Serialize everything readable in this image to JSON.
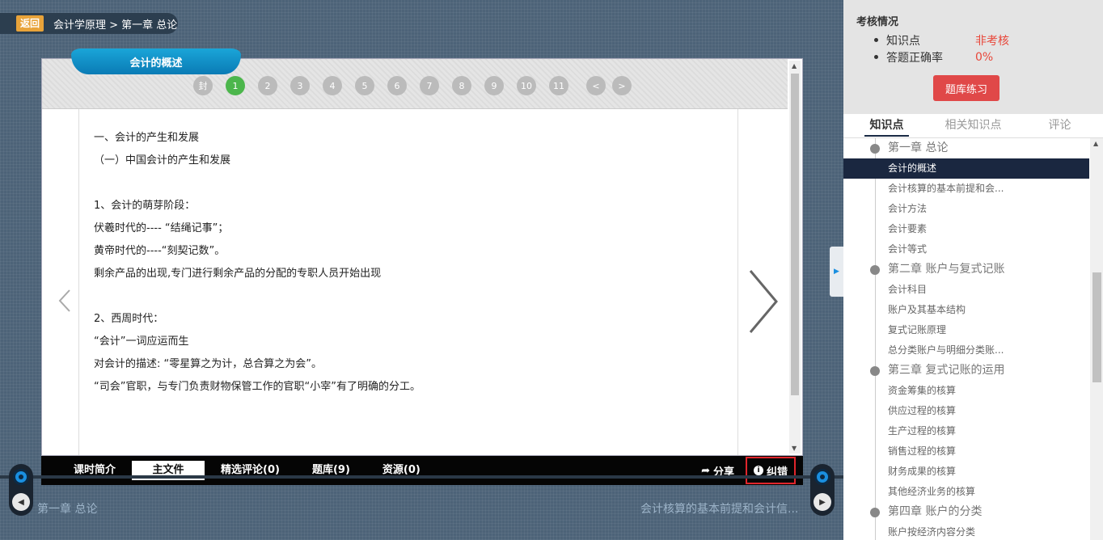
{
  "breadcrumb": {
    "back_label": "返回",
    "path": "会计学原理 > 第一章 总论"
  },
  "content": {
    "title_tab": "会计的概述",
    "pages": [
      "封",
      "1",
      "2",
      "3",
      "4",
      "5",
      "6",
      "7",
      "8",
      "9",
      "10",
      "11"
    ],
    "active_page": "1",
    "prev_page": "<",
    "next_page": ">",
    "lines": [
      "一、会计的产生和发展",
      "（一）中国会计的产生和发展",
      "",
      "1、会计的萌芽阶段：",
      "伏羲时代的---- “结绳记事”；",
      "黄帝时代的----“刻契记数”。",
      "剩余产品的出现,专门进行剩余产品的分配的专职人员开始出现",
      "",
      "2、西周时代：",
      "“会计”一词应运而生",
      "对会计的描述: “零星算之为计，总合算之为会”。",
      "“司会”官职，与专门负责财物保管工作的官职“小宰”有了明确的分工。"
    ]
  },
  "tabbar": {
    "tabs": [
      "课时简介",
      "主文件",
      "精选评论(0)",
      "题库(9)",
      "资源(0)"
    ],
    "active": "主文件",
    "share": "分享",
    "correct": "纠错"
  },
  "timeline": {
    "prev_label": "第一章 总论",
    "next_label": "会计核算的基本前提和会计信..."
  },
  "assessment": {
    "title": "考核情况",
    "rows": [
      {
        "label": "知识点",
        "value": "非考核"
      },
      {
        "label": "答题正确率",
        "value": "0%"
      }
    ],
    "practice_button": "题库练习"
  },
  "right_tabs": [
    "知识点",
    "相关知识点",
    "评论"
  ],
  "tree": [
    {
      "label": "第一章 总论",
      "type": "chapter"
    },
    {
      "label": "会计的概述",
      "type": "item",
      "active": true
    },
    {
      "label": "会计核算的基本前提和会...",
      "type": "item"
    },
    {
      "label": "会计方法",
      "type": "item"
    },
    {
      "label": "会计要素",
      "type": "item"
    },
    {
      "label": "会计等式",
      "type": "item"
    },
    {
      "label": "第二章 账户与复式记账",
      "type": "chapter"
    },
    {
      "label": "会计科目",
      "type": "item"
    },
    {
      "label": "账户及其基本结构",
      "type": "item"
    },
    {
      "label": "复式记账原理",
      "type": "item"
    },
    {
      "label": "总分类账户与明细分类账...",
      "type": "item"
    },
    {
      "label": "第三章 复式记账的运用",
      "type": "chapter"
    },
    {
      "label": "资金筹集的核算",
      "type": "item"
    },
    {
      "label": "供应过程的核算",
      "type": "item"
    },
    {
      "label": "生产过程的核算",
      "type": "item"
    },
    {
      "label": "销售过程的核算",
      "type": "item"
    },
    {
      "label": "财务成果的核算",
      "type": "item"
    },
    {
      "label": "其他经济业务的核算",
      "type": "item"
    },
    {
      "label": "第四章 账户的分类",
      "type": "chapter"
    },
    {
      "label": "账户按经济内容分类",
      "type": "item"
    }
  ],
  "colors": {
    "accent_blue": "#1a8fe0",
    "active_page_green": "#4cb64c",
    "alert_red": "#e04848",
    "back_orange": "#e8a33a"
  }
}
